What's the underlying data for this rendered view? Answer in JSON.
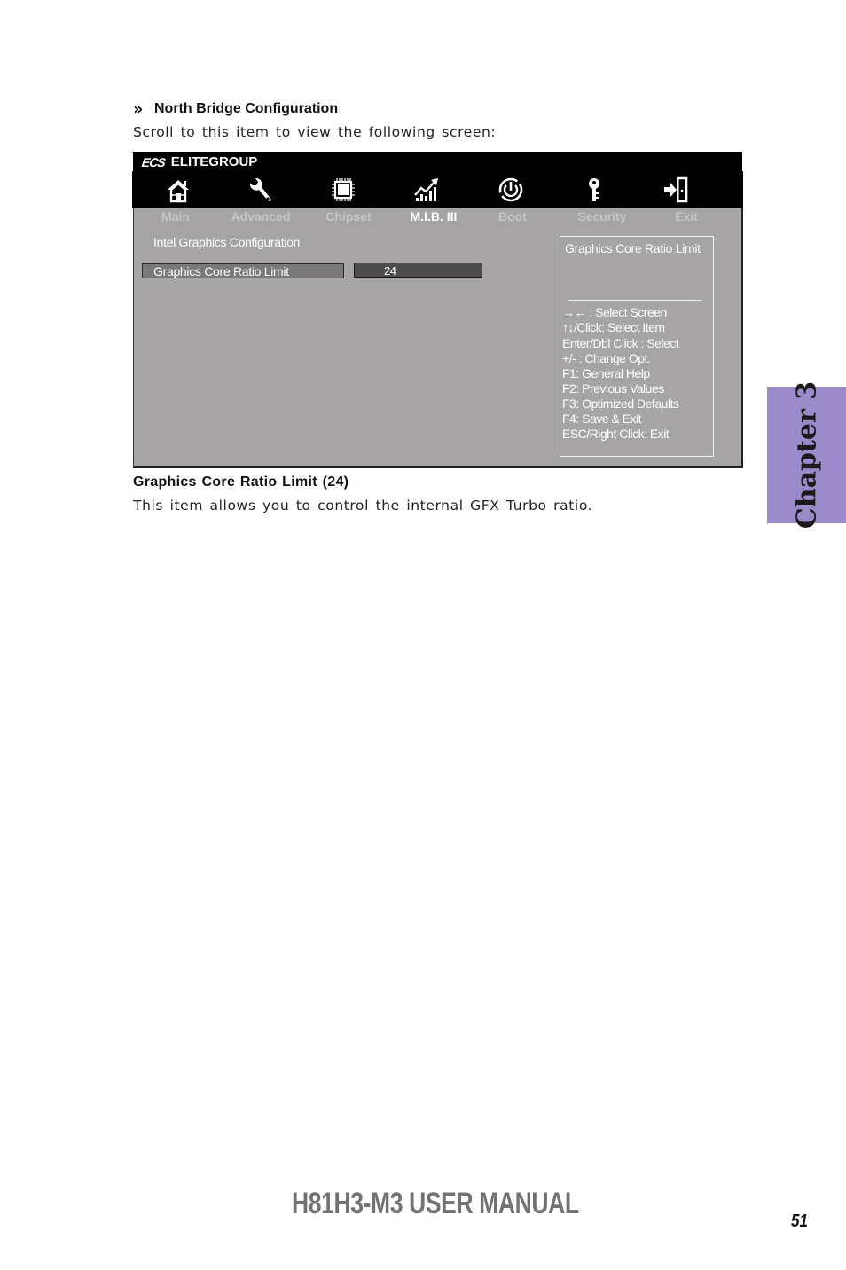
{
  "section": {
    "icon": "double-chevron-right-icon",
    "title": "North Bridge Configuration",
    "intro": "Scroll to this item to view the following screen:"
  },
  "bios": {
    "brand_logo": "ECS",
    "brand_name": "ELITEGROUP",
    "tabs": [
      {
        "label": "Main",
        "icon": "home-icon",
        "active": false
      },
      {
        "label": "Advanced",
        "icon": "wrench-icon",
        "active": false
      },
      {
        "label": "Chipset",
        "icon": "chip-icon",
        "active": false
      },
      {
        "label": "M.I.B. III",
        "icon": "performance-chart-icon",
        "active": true
      },
      {
        "label": "Boot",
        "icon": "power-icon",
        "active": false
      },
      {
        "label": "Security",
        "icon": "key-icon",
        "active": false
      },
      {
        "label": "Exit",
        "icon": "exit-door-icon",
        "active": false
      }
    ],
    "group_label": "Intel Graphics Configuration",
    "settings": [
      {
        "name": "Graphics Core Ratio Limit",
        "value": "24"
      }
    ],
    "help": {
      "title": "Graphics Core Ratio Limit",
      "keys": [
        "→←   : Select Screen",
        "↑↓/Click: Select Item",
        "Enter/Dbl Click : Select",
        "+/- : Change Opt.",
        "F1: General Help",
        "F2: Previous Values",
        "F3: Optimized Defaults",
        "F4: Save & Exit",
        "ESC/Right Click: Exit"
      ]
    },
    "colors": {
      "header": "#000000",
      "body": "#a6a4a5",
      "selected_name": "#7a7879",
      "value_box": "#4d4b4c"
    }
  },
  "item": {
    "heading": "Graphics Core Ratio Limit (24)",
    "description": "This item allows you to control the internal GFX Turbo ratio."
  },
  "side_tab": {
    "label": "Chapter 3",
    "color": "#9b8ac9"
  },
  "footer": {
    "manual_title": "H81H3-M3 USER MANUAL",
    "page_number": "51"
  }
}
